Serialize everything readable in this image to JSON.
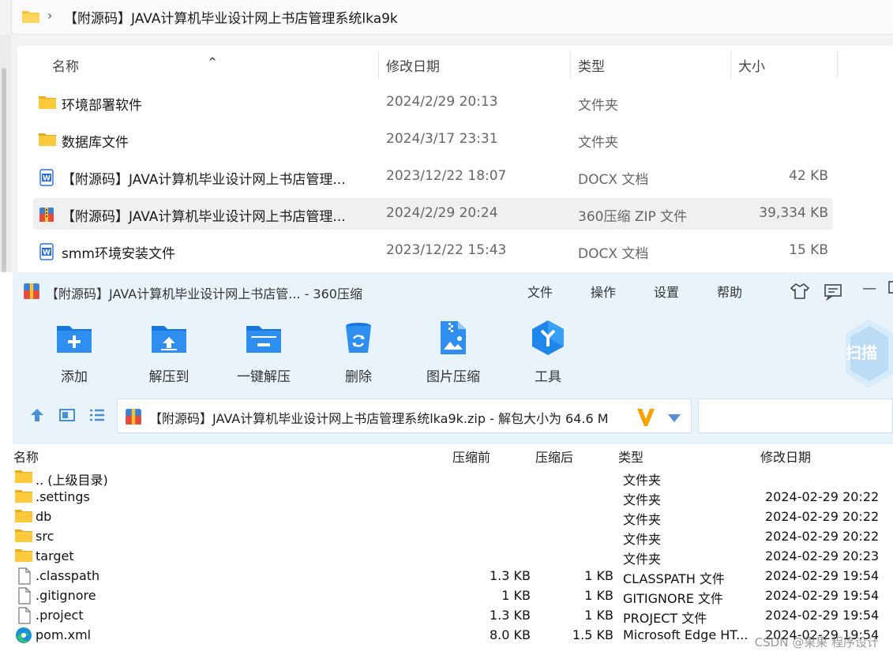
{
  "explorer": {
    "breadcrumb": "【附源码】JAVA计算机毕业设计网上书店管理系统lka9k",
    "columns": {
      "name": "名称",
      "modified": "修改日期",
      "type": "类型",
      "size": "大小"
    },
    "rows": [
      {
        "name": "环境部署软件",
        "modified": "2024/2/29 20:13",
        "type": "文件夹",
        "size": "",
        "icon": "folder-icon"
      },
      {
        "name": "数据库文件",
        "modified": "2024/3/17 23:31",
        "type": "文件夹",
        "size": "",
        "icon": "folder-icon"
      },
      {
        "name": "【附源码】JAVA计算机毕业设计网上书店管理...",
        "modified": "2023/12/22 18:07",
        "type": "DOCX 文档",
        "size": "42 KB",
        "icon": "word-doc-icon"
      },
      {
        "name": "【附源码】JAVA计算机毕业设计网上书店管理...",
        "modified": "2024/2/29 20:24",
        "type": "360压缩 ZIP 文件",
        "size": "39,334 KB",
        "icon": "zip-archive-icon",
        "selected": true
      },
      {
        "name": "smm环境安装文件",
        "modified": "2023/12/22 15:43",
        "type": "DOCX 文档",
        "size": "15 KB",
        "icon": "word-doc-icon"
      }
    ]
  },
  "zip": {
    "title": "【附源码】JAVA计算机毕业设计网上书店管... - 360压缩",
    "menu": [
      "文件",
      "操作",
      "设置",
      "帮助"
    ],
    "tools": [
      {
        "label": "添加",
        "icon": "add-icon"
      },
      {
        "label": "解压到",
        "icon": "extract-to-icon"
      },
      {
        "label": "一键解压",
        "icon": "one-click-extract-icon"
      },
      {
        "label": "删除",
        "icon": "delete-icon"
      },
      {
        "label": "图片压缩",
        "icon": "image-compress-icon"
      },
      {
        "label": "工具",
        "icon": "tools-icon"
      }
    ],
    "scan_label": "扫描",
    "path": "【附源码】JAVA计算机毕业设计网上书店管理系统lka9k.zip - 解包大小为 64.6 M",
    "columns": {
      "name": "名称",
      "before": "压缩前",
      "after": "压缩后",
      "type": "类型",
      "modified": "修改日期"
    },
    "rows": [
      {
        "name": ".. (上级目录)",
        "before": "",
        "after": "",
        "type": "文件夹",
        "modified": "",
        "icon": "folder-icon"
      },
      {
        "name": ".settings",
        "before": "",
        "after": "",
        "type": "文件夹",
        "modified": "2024-02-29 20:22",
        "icon": "folder-icon"
      },
      {
        "name": "db",
        "before": "",
        "after": "",
        "type": "文件夹",
        "modified": "2024-02-29 20:22",
        "icon": "folder-icon"
      },
      {
        "name": "src",
        "before": "",
        "after": "",
        "type": "文件夹",
        "modified": "2024-02-29 20:22",
        "icon": "folder-icon"
      },
      {
        "name": "target",
        "before": "",
        "after": "",
        "type": "文件夹",
        "modified": "2024-02-29 20:23",
        "icon": "folder-icon"
      },
      {
        "name": ".classpath",
        "before": "1.3 KB",
        "after": "1 KB",
        "type": "CLASSPATH 文件",
        "modified": "2024-02-29 19:54",
        "icon": "file-icon"
      },
      {
        "name": ".gitignore",
        "before": "1 KB",
        "after": "1 KB",
        "type": "GITIGNORE 文件",
        "modified": "2024-02-29 19:54",
        "icon": "file-icon"
      },
      {
        "name": ".project",
        "before": "1.3 KB",
        "after": "1 KB",
        "type": "PROJECT 文件",
        "modified": "2024-02-29 19:54",
        "icon": "file-icon"
      },
      {
        "name": "pom.xml",
        "before": "8.0 KB",
        "after": "1.5 KB",
        "type": "Microsoft Edge HT...",
        "modified": "2024-02-29 19:54",
        "icon": "edge-icon"
      }
    ]
  },
  "watermark": "CSDN @果果 程序设计",
  "colors": {
    "accent": "#1e88e5",
    "folder": "#f5c33b",
    "zip_bg": "#e9f3fc"
  }
}
